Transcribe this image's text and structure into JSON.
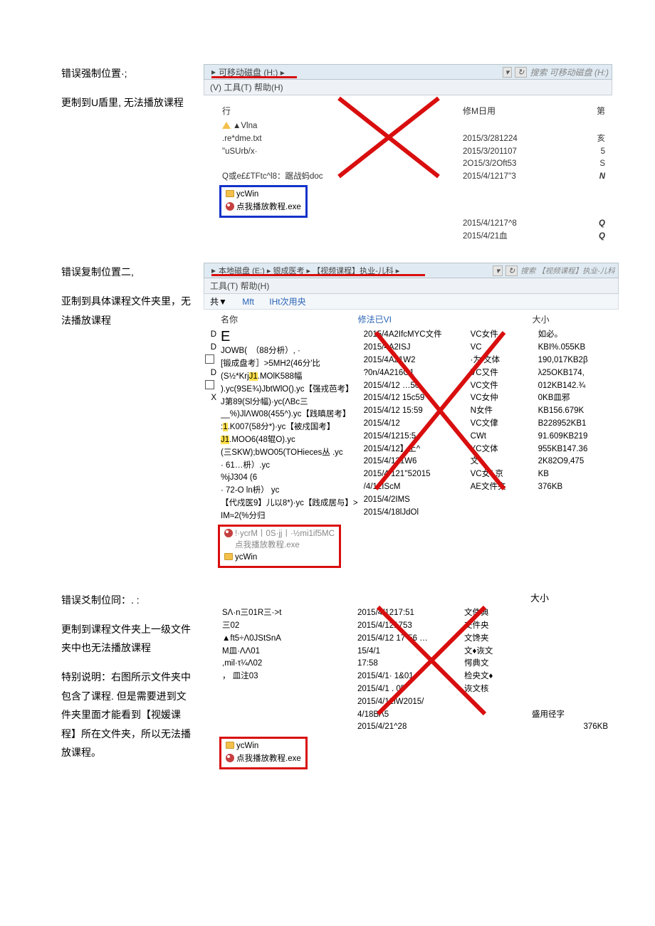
{
  "section1": {
    "left": {
      "l1": "错误强制位置·;",
      "l2": "更制到U盾里, 无法播放课程"
    },
    "addr": {
      "pre": "▸",
      "path": "可移动磁盘 (H:)  ▸",
      "btn1": "▾",
      "btn2": "↻",
      "search": "搜索 可移动磁盘 (H:)",
      "underlineW": "120px"
    },
    "menu": "(V)   工具(T)   帮助(H)",
    "hdr": {
      "c1": "行",
      "c2": "修M日用",
      "c3": "第"
    },
    "rows": [
      {
        "name": "▲Vlna",
        "icon": "tri",
        "date": "",
        "t": ""
      },
      {
        "name": ".re*dme.txt",
        "date": "2015/3/281224",
        "t": "亥"
      },
      {
        "name": "\"uSUrb/x·",
        "date": "2015/3/201107",
        "t": "5"
      },
      {
        "name": "",
        "date": "2O15/3/2Oft53",
        "t": "S"
      },
      {
        "name": "Q或e££TFtc^l8：踞战蚂doc",
        "date": "2015/4/1217''3",
        "t": "N",
        "italic": true
      }
    ],
    "bluebox": {
      "a": "ycWin",
      "b": "点我播放教程.exe"
    },
    "bluedates": [
      {
        "date": "2015/4/1217^8",
        "t": "Q"
      },
      {
        "date": "2015/4/21血",
        "t": "Q"
      }
    ]
  },
  "section2": {
    "left": {
      "l1": "错误复制位置二,",
      "l2": "亚制到具体课程文件夹里，无法播放课程"
    },
    "addr": {
      "pre": "▸",
      "path": "本地磁盘 (E:)  ▸  银成医考  ▸  【视频课程】执业-儿科  ▸",
      "btn1": "▾",
      "btn2": "↻",
      "search": "搜索 【视频课程】执业-儿科",
      "underlineW": "300px"
    },
    "menu": "工具(T)   帮助(H)",
    "toolbar": {
      "a": "共▼",
      "b": "Mft",
      "c": "IHt次用央"
    },
    "hdrA": "名你",
    "hdrB": "修法已VI",
    "hdrC": "",
    "hdrD": "大小",
    "colA_lead": "Ε",
    "colA": [
      "JOWB(　（88分枡）,   ·",
      "[锻成盘考］>5MH2(46分'比",
      "(S½*KrjJ1.MOlK588幅",
      ").yc(9SE¾)JbtWlO().yc【强戎芭考】",
      "J第89(Sl分幅)·yc(ΛBc三",
      "__%)JlΛW08(455^).yc【践瞋居考】",
      ":1.K007(58分*)·yc【被戍国考】",
      "J1.MOO6(48辊O).yc",
      "(三SKW);bWO05(TOHieces丛   .yc",
      "·  61…枡）.yc",
      "%jJ304 (6",
      "· 72-O ln枡） yc",
      "【代戍医9】儿以8*)·yc【践成居与】>",
      "IM≈2(%分归"
    ],
    "sideGlyphs": [
      "D",
      "D",
      "□",
      "",
      "",
      "",
      "",
      "",
      "D",
      "□",
      "X",
      ""
    ],
    "colB": [
      "2015/4A2IfcMYC文件",
      "2015/4A2ISJ",
      "2015/4A21W2",
      "?0n/4A216O1",
      "2015/4/12   …50",
      "2015/4/12   15c59",
      "2015/4/12   15:59",
      "2015/4/12",
      "2015/4/1215:5",
      "2015/4/12】上^",
      "",
      "2015/4/121W6",
      "2015/4/121''52015",
      "/4/12IScM",
      "2015/4/2IMS",
      "2015/4/18lJdOl"
    ],
    "colC": [
      "",
      "VC女件",
      "VC",
      "·为 文体",
      "VC又件",
      "VC文件",
      "VC女仲",
      "",
      "N女件",
      "VC文侓",
      "CWt",
      "YC文体",
      "文\"",
      "VC女\" 京",
      "AE文件夹",
      ""
    ],
    "colD": [
      "如必。",
      "KBI%.055KB",
      "190,017KB2β",
      "λ25OKB174,",
      "012KB142.¾",
      "0KB皿邪",
      "KB156.679K",
      "B228952KB1",
      "91.609KB219",
      "955KB147.36",
      "2K82O9,475",
      "KB",
      "",
      "376KB",
      "",
      ""
    ],
    "redbox": {
      "a": "!·ycrM丨0S·jj丨·½mi1if5MC",
      "a2": "点我播放教程.exe",
      "b": "ycWin"
    }
  },
  "section3": {
    "left": {
      "l1": "错误爻制位冏：. :",
      "l2": "更制到课程文件夹上一级文件夹中也无法播放课程",
      "l3": "特别说明：右图所示文件夹中包含了课程. 但是需要进到文件夹里面才能看到【视媛课程】所在文件夹，所以无法播放课程。"
    },
    "hdrD": "大小",
    "colA": [
      "SΛ·n三01R三·>t",
      "三02",
      "▲ft5÷Λ0JStSnA",
      "M皿·ΛΛ01",
      ",mil·τ¼Λ02",
      "，    皿注03"
    ],
    "colB": [
      "2015/4/1217:51",
      "2015/4/121753",
      "2015/4/12  17\"56   …",
      "15/4/1",
      "         17:58",
      "2015/4/1·      1&01",
      "2015/4/1    .   05",
      "2015/4/12lW2015/",
      "4/18BΛ5",
      "2015/4/21^28"
    ],
    "colC": [
      "文件典",
      "交件央",
      "文馋夹",
      "文♦诙文",
      "愕典文",
      "检央文♦",
      "诙文核",
      "",
      "",
      ""
    ],
    "colD_last": "盛用径字",
    "colD_size": "376KB",
    "redbox": {
      "a": "ycWin",
      "b": "点我播放教程.exe"
    }
  }
}
